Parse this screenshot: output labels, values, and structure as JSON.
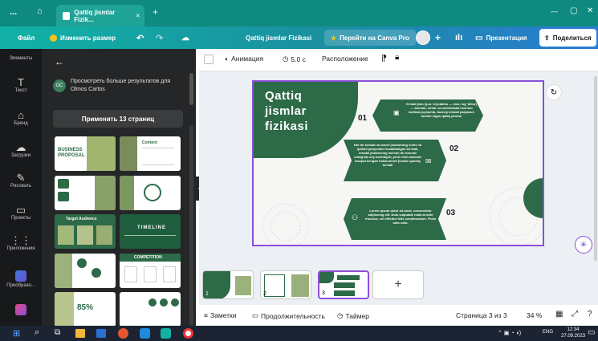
{
  "browser": {
    "menu_dots": "...",
    "tab_title": "Qattiq jismlar Fizik...",
    "tab_close": "×",
    "new_tab": "+",
    "window_min": "—",
    "window_max": "▢",
    "window_close": "✕"
  },
  "header": {
    "file": "Файл",
    "resize": "Изменить размер",
    "doc_title": "Qattiq jismlar Fizikasi",
    "canva_pro": "Перейти на Canva Pro",
    "present": "Презентация",
    "share": "Поделиться"
  },
  "rail": {
    "elements": "Элементы",
    "items": [
      {
        "label": "Текст",
        "icon": "text-icon"
      },
      {
        "label": "Бренд",
        "icon": "brand-icon"
      },
      {
        "label": "Загрузки",
        "icon": "upload-icon"
      },
      {
        "label": "Рисовать",
        "icon": "draw-icon"
      },
      {
        "label": "Проекты",
        "icon": "folder-icon"
      },
      {
        "label": "Приложения",
        "icon": "apps-icon"
      },
      {
        "label": "Преобразо...",
        "icon": "transform-icon"
      }
    ]
  },
  "panel": {
    "more_results": "Просмотреть больше результатов для Olmos Cartos",
    "avatar_initials": "OC",
    "apply_pages": "Применить 13 страниц",
    "thumbs": [
      {
        "title": "BUSINESS PROPOSAL",
        "bg": "#ffffff"
      },
      {
        "title": "Content",
        "bg": "#ffffff"
      },
      {
        "title": "",
        "bg": "#ffffff"
      },
      {
        "title": "",
        "bg": "#ffffff"
      },
      {
        "title": "Target Audience",
        "bg": "#2d6a47"
      },
      {
        "title": "TIMELINE",
        "bg": "#1f5e3e"
      },
      {
        "title": "",
        "bg": "#ffffff"
      },
      {
        "title": "COMPETITION",
        "bg": "#ffffff"
      },
      {
        "title": "85%",
        "bg": "#ffffff"
      },
      {
        "title": "",
        "bg": "#ffffff"
      }
    ]
  },
  "toolbar": {
    "animation": "Анимация",
    "duration": "5.0 с",
    "position": "Расположение"
  },
  "slide": {
    "title_line1": "Qattiq",
    "title_line2": "jismlar",
    "title_line3": "fizikasi",
    "items": [
      {
        "num": "01",
        "text": "Kristal jism (yun. krystallos — muz, log' billur) — atomlar, ionlar va molekulalari ma'lum tartibda joylashib, fazoviy kristall panjarani tashkil etgan qattiq jismlar"
      },
      {
        "num": "02",
        "text": "Har bir kristall va amorf jismlarning erishi va qotishi jarayonlari kuzatiladigan bo'lsak, kristall jismlarning ma'lum bir harorat oralig'ida eriy boshlaydi; ya'ni erish harorati mavjud bo'lgan holda amorf jismlar qanday bo'ladi"
      },
      {
        "num": "03",
        "text": "Lorem ipsum dolor sit amet, consectetur adipiscing elit. Duis vulputate nulla at ante rhoncus, vel efficitur felis condimentum. Proin odio odio."
      }
    ]
  },
  "footer": {
    "notes": "Заметки",
    "duration": "Продолжительность",
    "timer": "Таймер",
    "page": "Страница 3 из 3",
    "zoom": "34 %"
  },
  "strip": {
    "nums": [
      "1",
      "2",
      "3"
    ],
    "add": "+"
  },
  "taskbar": {
    "lang": "ENG",
    "time": "12:34",
    "date": "27.09.2023"
  },
  "colors": {
    "slide_green": "#2d6a47",
    "accent_purple": "#8b4fd8",
    "teal": "#11b2a5"
  }
}
